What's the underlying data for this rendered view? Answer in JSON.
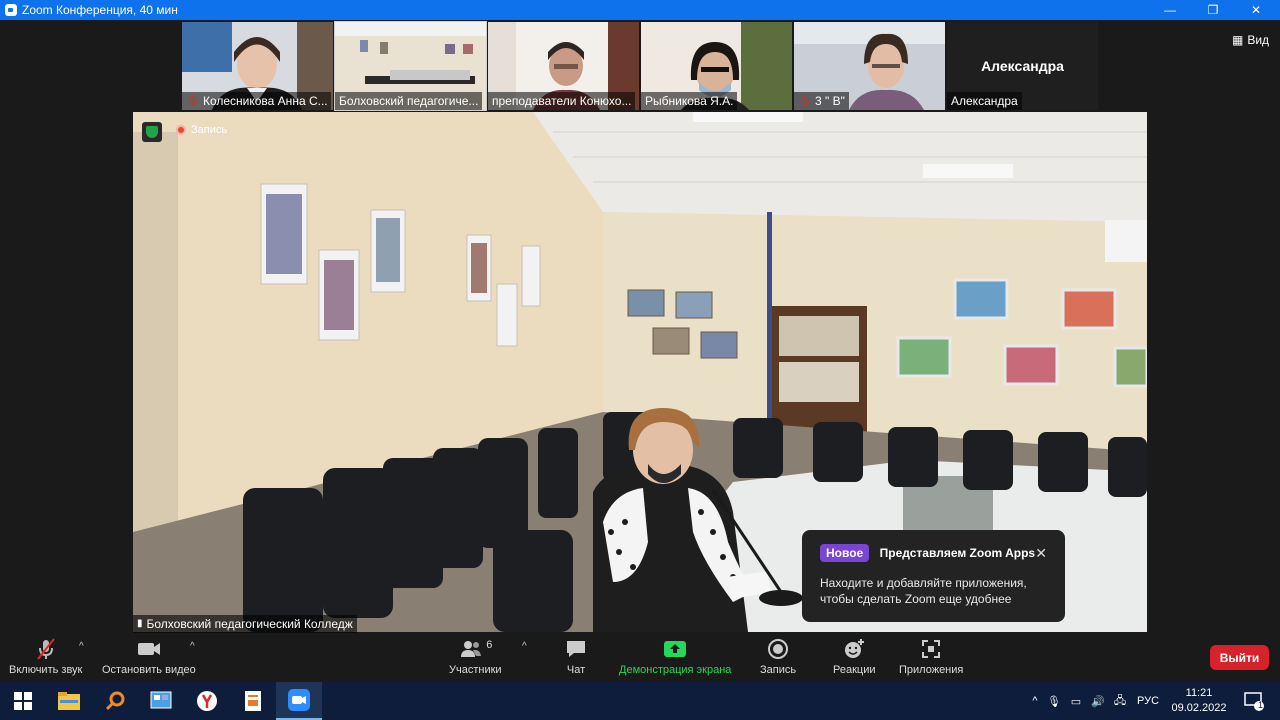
{
  "window": {
    "title": "Zoom Конференция, 40 мин",
    "minimize": "―",
    "restore": "❐",
    "close": "✕"
  },
  "thumbnails": [
    {
      "name": "Колесникова Анна С...",
      "muted": true
    },
    {
      "name": "Болховский педагогиче...",
      "muted": false
    },
    {
      "name": "преподаватели Конюхо...",
      "muted": false
    },
    {
      "name": "Рыбникова Я.А.",
      "muted": false
    },
    {
      "name": "3 \" В\"",
      "muted": true
    },
    {
      "name": "Александра",
      "muted": false,
      "big_name": "Александра"
    }
  ],
  "view_button": "Вид",
  "recording_label": "Запись",
  "speaker_name": "Болховский педагогический Колледж",
  "toast": {
    "badge": "Новое",
    "title": "Представляем Zoom Apps",
    "body": "Находите и добавляйте приложения, чтобы сделать Zoom еще удобнее"
  },
  "toolbar": {
    "unmute": "Включить звук",
    "stop_video": "Остановить видео",
    "participants": "Участники",
    "participants_count": "6",
    "chat": "Чат",
    "share_screen": "Демонстрация экрана",
    "record": "Запись",
    "reactions": "Реакции",
    "apps": "Приложения",
    "exit": "Выйти"
  },
  "taskbar": {
    "language": "РУС",
    "time": "11:21",
    "date": "09.02.2022",
    "notifications": "1"
  },
  "colors": {
    "zoom_blue": "#0e72ed",
    "share_green": "#23d959",
    "exit_red": "#d6222a",
    "new_badge": "#7b45d3"
  }
}
